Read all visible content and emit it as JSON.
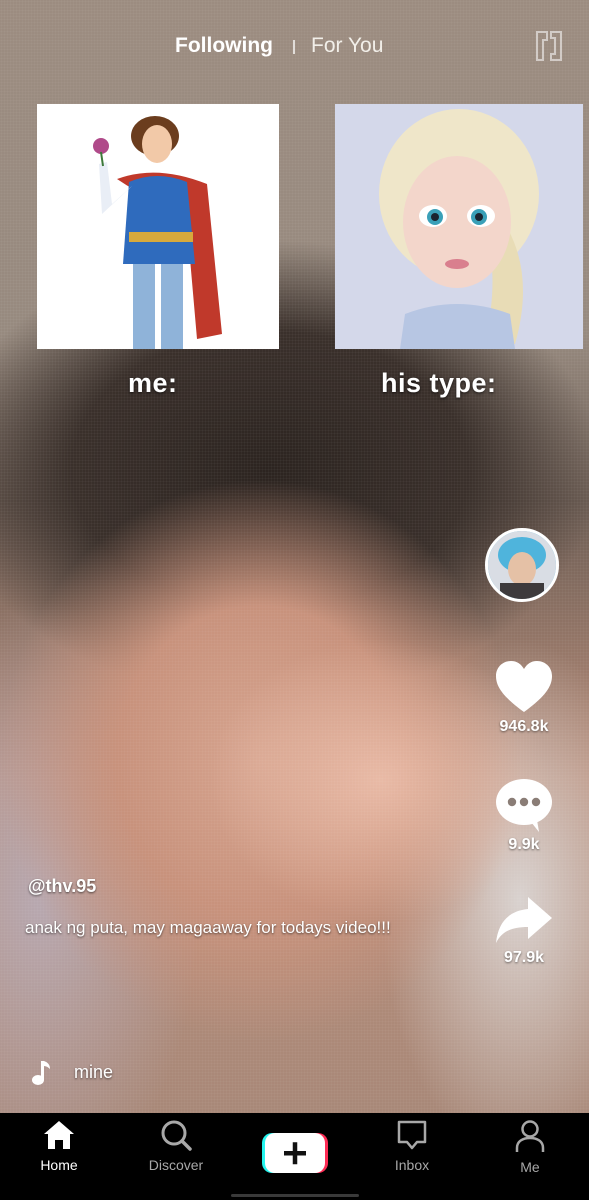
{
  "top_nav": {
    "following_label": "Following",
    "for_you_label": "For You",
    "active_tab": "Following"
  },
  "meme": {
    "left_label": "me:",
    "right_label": "his type:"
  },
  "actions": {
    "likes": "946.8k",
    "comments": "9.9k",
    "shares": "97.9k"
  },
  "post": {
    "username": "@thv.95",
    "caption": "anak ng puta, may magaaway for todays video!!!",
    "sound": "mine"
  },
  "bottom_nav": {
    "items": [
      {
        "label": "Home",
        "icon": "home-icon"
      },
      {
        "label": "Discover",
        "icon": "search-icon"
      },
      {
        "label": "",
        "icon": "plus-icon"
      },
      {
        "label": "Inbox",
        "icon": "inbox-icon"
      },
      {
        "label": "Me",
        "icon": "person-icon"
      }
    ]
  },
  "colors": {
    "nav_bg": "#000000",
    "text": "#ffffff",
    "inactive_label": "#a8a8a8",
    "accent_cyan": "#25f4ee",
    "accent_red": "#fe2c55"
  }
}
